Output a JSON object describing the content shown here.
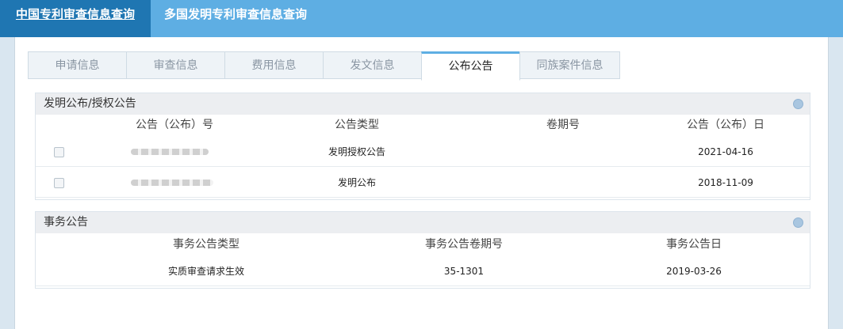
{
  "topnav": {
    "items": [
      "中国专利审查信息查询",
      "多国发明专利审查信息查询"
    ]
  },
  "tabs": [
    "申请信息",
    "审查信息",
    "费用信息",
    "发文信息",
    "公布公告",
    "同族案件信息"
  ],
  "publication": {
    "title": "发明公布/授权公告",
    "headers": [
      "公告（公布）号",
      "公告类型",
      "卷期号",
      "公告（公布）日"
    ],
    "rows": [
      {
        "type": "发明授权公告",
        "volume": "",
        "date": "2021-04-16"
      },
      {
        "type": "发明公布",
        "volume": "",
        "date": "2018-11-09"
      }
    ]
  },
  "affairs": {
    "title": "事务公告",
    "headers": [
      "事务公告类型",
      "事务公告卷期号",
      "事务公告日"
    ],
    "rows": [
      {
        "type": "实质审查请求生效",
        "volume": "35-1301",
        "date": "2019-03-26"
      }
    ]
  }
}
